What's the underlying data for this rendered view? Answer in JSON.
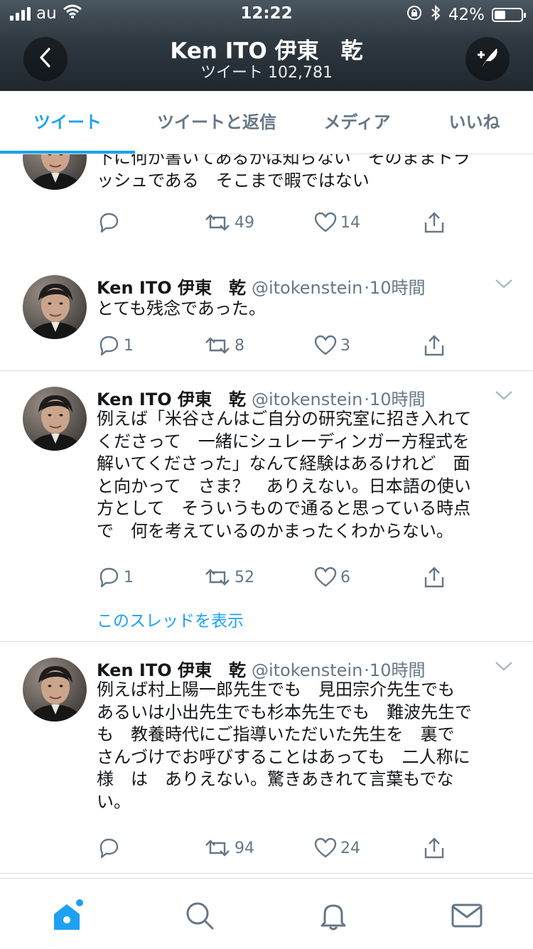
{
  "status_bar": {
    "carrier": "au",
    "time": "12:22",
    "battery": "42%",
    "battery_level": 0.42
  },
  "header": {
    "title": "Ken ITO 伊東　乾",
    "subtitle": "ツイート 102,781"
  },
  "tabs": [
    {
      "label": "ツイート",
      "active": true
    },
    {
      "label": "ツイートと返信",
      "active": false
    },
    {
      "label": "メディア",
      "active": false
    },
    {
      "label": "いいね",
      "active": false
    }
  ],
  "tweets": [
    {
      "name": "",
      "handle": "",
      "time": "",
      "lines": [
        "下に何が書いてあるかは知らない　そのままトラ",
        "ッシュである　そこまで暇ではない"
      ],
      "reply_count": "",
      "retweet_count": "49",
      "like_count": "14"
    },
    {
      "name": "Ken ITO 伊東　乾",
      "handle": "@itokenstein",
      "time": "·10時間",
      "lines": [
        "とても残念であった。"
      ],
      "reply_count": "1",
      "retweet_count": "8",
      "like_count": "3"
    },
    {
      "name": "Ken ITO 伊東　乾",
      "handle": "@itokenstein",
      "time": "·10時間",
      "lines": [
        "例えば「米谷さんはご自分の研究室に招き入れて",
        "くださって　一緒にシュレーディンガー方程式を",
        "解いてくださった」なんて経験はあるけれど　面",
        "と向かって　さま？　ありえない。日本語の使い",
        "方として　そういうもので通ると思っている時点",
        "で　何を考えているのかまったくわからない。"
      ],
      "reply_count": "1",
      "retweet_count": "52",
      "like_count": "6",
      "thread_link": "このスレッドを表示"
    },
    {
      "name": "Ken ITO 伊東　乾",
      "handle": "@itokenstein",
      "time": "·10時間",
      "lines": [
        "例えば村上陽一郎先生でも　見田宗介先生でも",
        "あるいは小出先生でも杉本先生でも　難波先生で",
        "も　教養時代にご指導いただいた先生を　裏で",
        "さんづけでお呼びすることはあっても　二人称に",
        "様　は　ありえない。驚きあきれて言葉もでな",
        "い。"
      ],
      "reply_count": "",
      "retweet_count": "94",
      "like_count": "24"
    }
  ],
  "icons": {
    "back": "chevron-left-icon",
    "compose": "compose-feather-icon",
    "reply": "reply-icon",
    "retweet": "retweet-icon",
    "like": "heart-icon",
    "share": "share-icon",
    "caret": "chevron-down-icon",
    "tabbar": [
      "home-icon",
      "search-icon",
      "bell-icon",
      "mail-icon"
    ]
  },
  "colors": {
    "accent": "#1da1f2",
    "secondary_text": "#657786",
    "divider": "#d8dde1"
  }
}
